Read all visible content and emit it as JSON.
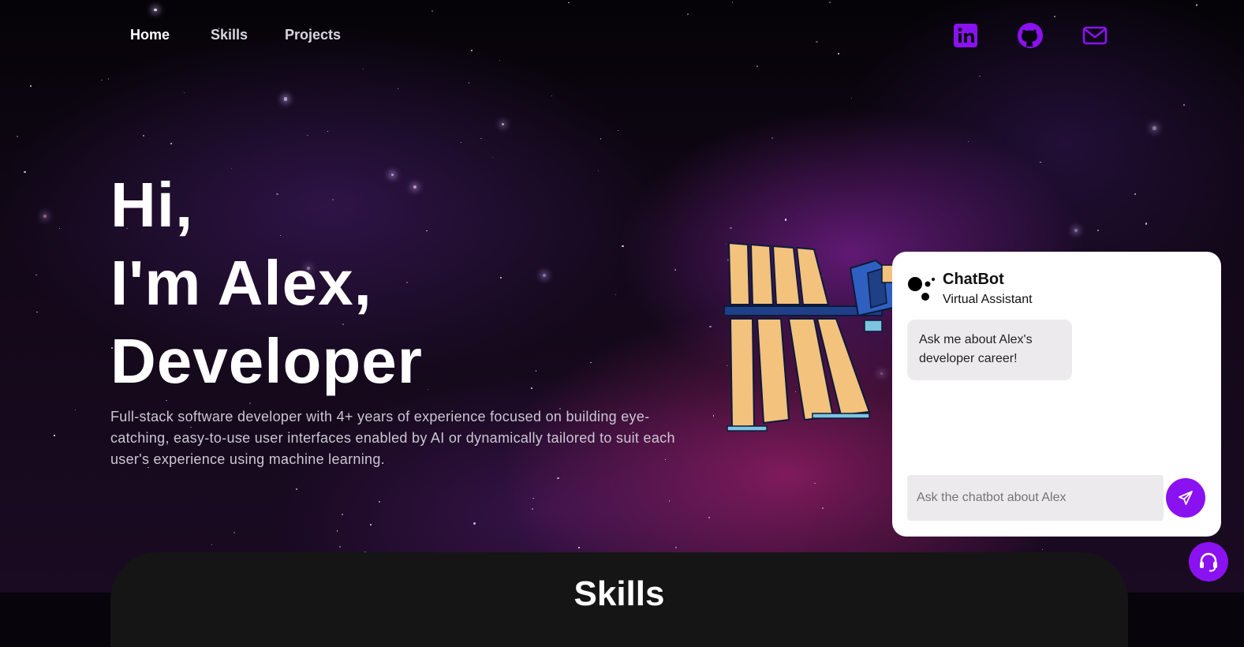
{
  "nav": {
    "items": [
      {
        "label": "Home",
        "active": true
      },
      {
        "label": "Skills",
        "active": false
      },
      {
        "label": "Projects",
        "active": false
      }
    ],
    "social": [
      {
        "icon": "linkedin-icon"
      },
      {
        "icon": "github-icon"
      },
      {
        "icon": "mail-icon"
      }
    ]
  },
  "hero": {
    "line1": "Hi,",
    "line2": "I'm Alex,",
    "line3": "Developer",
    "description": "Full-stack software developer with 4+ years of experience focused on building eye-catching, easy-to-use user interfaces enabled by AI or dynamically tailored to suit each user's experience using machine learning."
  },
  "chatbot": {
    "name": "ChatBot",
    "subtitle": "Virtual Assistant",
    "messages": [
      {
        "from": "bot",
        "text": "Ask me about Alex's developer career!"
      }
    ],
    "input_placeholder": "Ask the chatbot about Alex",
    "send_icon": "send-icon",
    "support_icon": "headset-icon"
  },
  "skills_section": {
    "title": "Skills"
  },
  "colors": {
    "accent": "#8a12f0",
    "panel": "#151515",
    "chat_bg": "#ffffff"
  }
}
